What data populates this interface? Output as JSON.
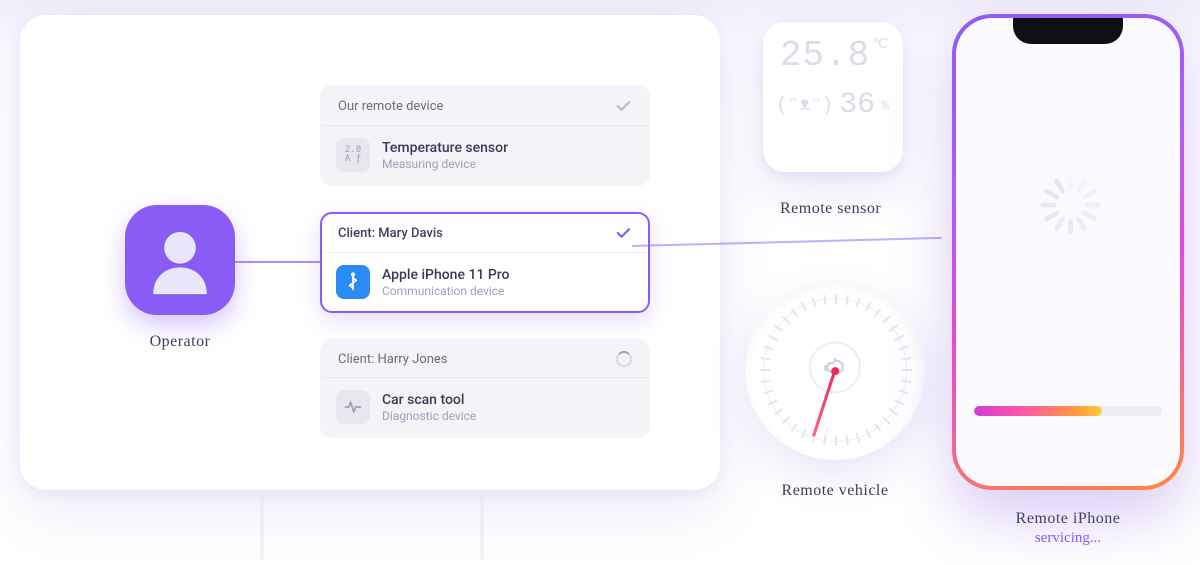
{
  "operator": {
    "label": "Operator"
  },
  "cards": [
    {
      "header": "Our remote device",
      "status": "done",
      "device_title": "Temperature sensor",
      "device_subtitle": "Measuring device"
    },
    {
      "header": "Client: Mary Davis",
      "status": "selected",
      "device_title": "Apple iPhone 11 Pro",
      "device_subtitle": "Communication device"
    },
    {
      "header": "Client: Harry Jones",
      "status": "loading",
      "device_title": "Car scan tool",
      "device_subtitle": "Diagnostic device"
    }
  ],
  "sensor": {
    "label": "Remote sensor",
    "temperature_value": "25.8",
    "temperature_unit": "℃",
    "humidity_value": "36",
    "humidity_unit": "%",
    "face": "(ᵔᴥᵔ)"
  },
  "gauge": {
    "label": "Remote vehicle"
  },
  "phone": {
    "label": "Remote iPhone",
    "status_text": "servicing...",
    "progress_pct": 68
  },
  "colors": {
    "accent": "#8a5cf6",
    "needle": "#eb2a5a",
    "gradient_start": "#8a5cf6",
    "gradient_end": "#ff8a3d"
  }
}
